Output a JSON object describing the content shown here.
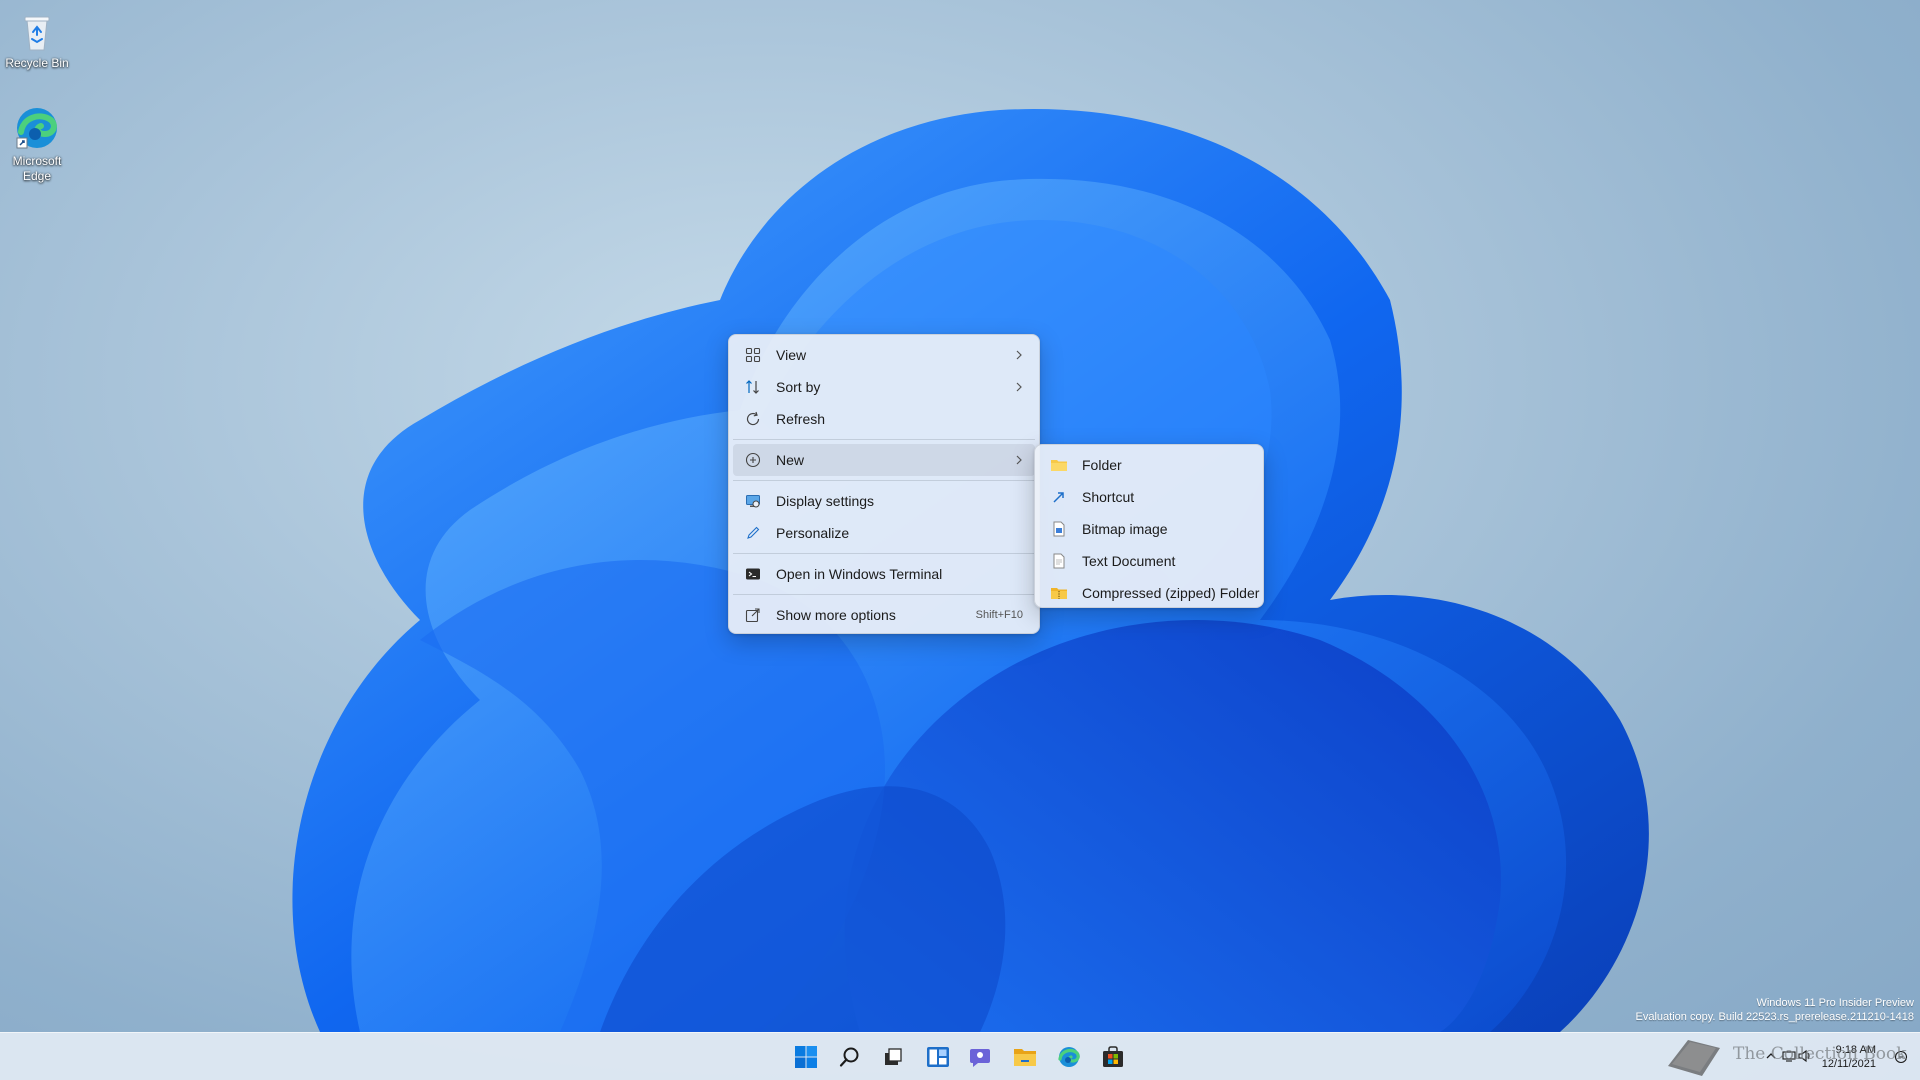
{
  "desktop": {
    "icons": [
      {
        "label": "Recycle Bin"
      },
      {
        "label": "Microsoft Edge"
      }
    ]
  },
  "context_menu": {
    "items": [
      {
        "label": "View",
        "icon": "grid-view-icon",
        "submenu": true
      },
      {
        "label": "Sort by",
        "icon": "sort-arrows-icon",
        "submenu": true
      },
      {
        "label": "Refresh",
        "icon": "refresh-icon",
        "submenu": false
      },
      {
        "label": "New",
        "icon": "plus-circle-icon",
        "submenu": true,
        "highlighted": true
      },
      {
        "label": "Display settings",
        "icon": "display-icon",
        "submenu": false
      },
      {
        "label": "Personalize",
        "icon": "pen-icon",
        "submenu": false
      },
      {
        "label": "Open in Windows Terminal",
        "icon": "terminal-icon",
        "submenu": false
      },
      {
        "label": "Show more options",
        "icon": "share-icon",
        "shortcut": "Shift+F10"
      }
    ]
  },
  "new_submenu": {
    "items": [
      {
        "label": "Folder",
        "icon": "folder-icon"
      },
      {
        "label": "Shortcut",
        "icon": "shortcut-arrow-icon"
      },
      {
        "label": "Bitmap image",
        "icon": "bitmap-icon"
      },
      {
        "label": "Text Document",
        "icon": "text-document-icon"
      },
      {
        "label": "Compressed (zipped) Folder",
        "icon": "zip-folder-icon"
      }
    ]
  },
  "watermark": {
    "line1": "Windows 11 Pro Insider Preview",
    "line2": "Evaluation copy. Build 22523.rs_prerelease.211210-1418"
  },
  "taskbar": {
    "apps": [
      "start-icon",
      "search-icon",
      "task-view-icon",
      "widgets-icon",
      "chat-icon",
      "file-explorer-icon",
      "edge-icon",
      "store-icon"
    ],
    "clock": {
      "time": "9:18 AM",
      "date": "12/11/2021"
    }
  },
  "overlay": {
    "brand": "The Collection Book"
  },
  "colors": {
    "accent": "#0067c0",
    "menu_bg": "#ecf0f7",
    "taskbar_bg": "#e2eaf4"
  }
}
